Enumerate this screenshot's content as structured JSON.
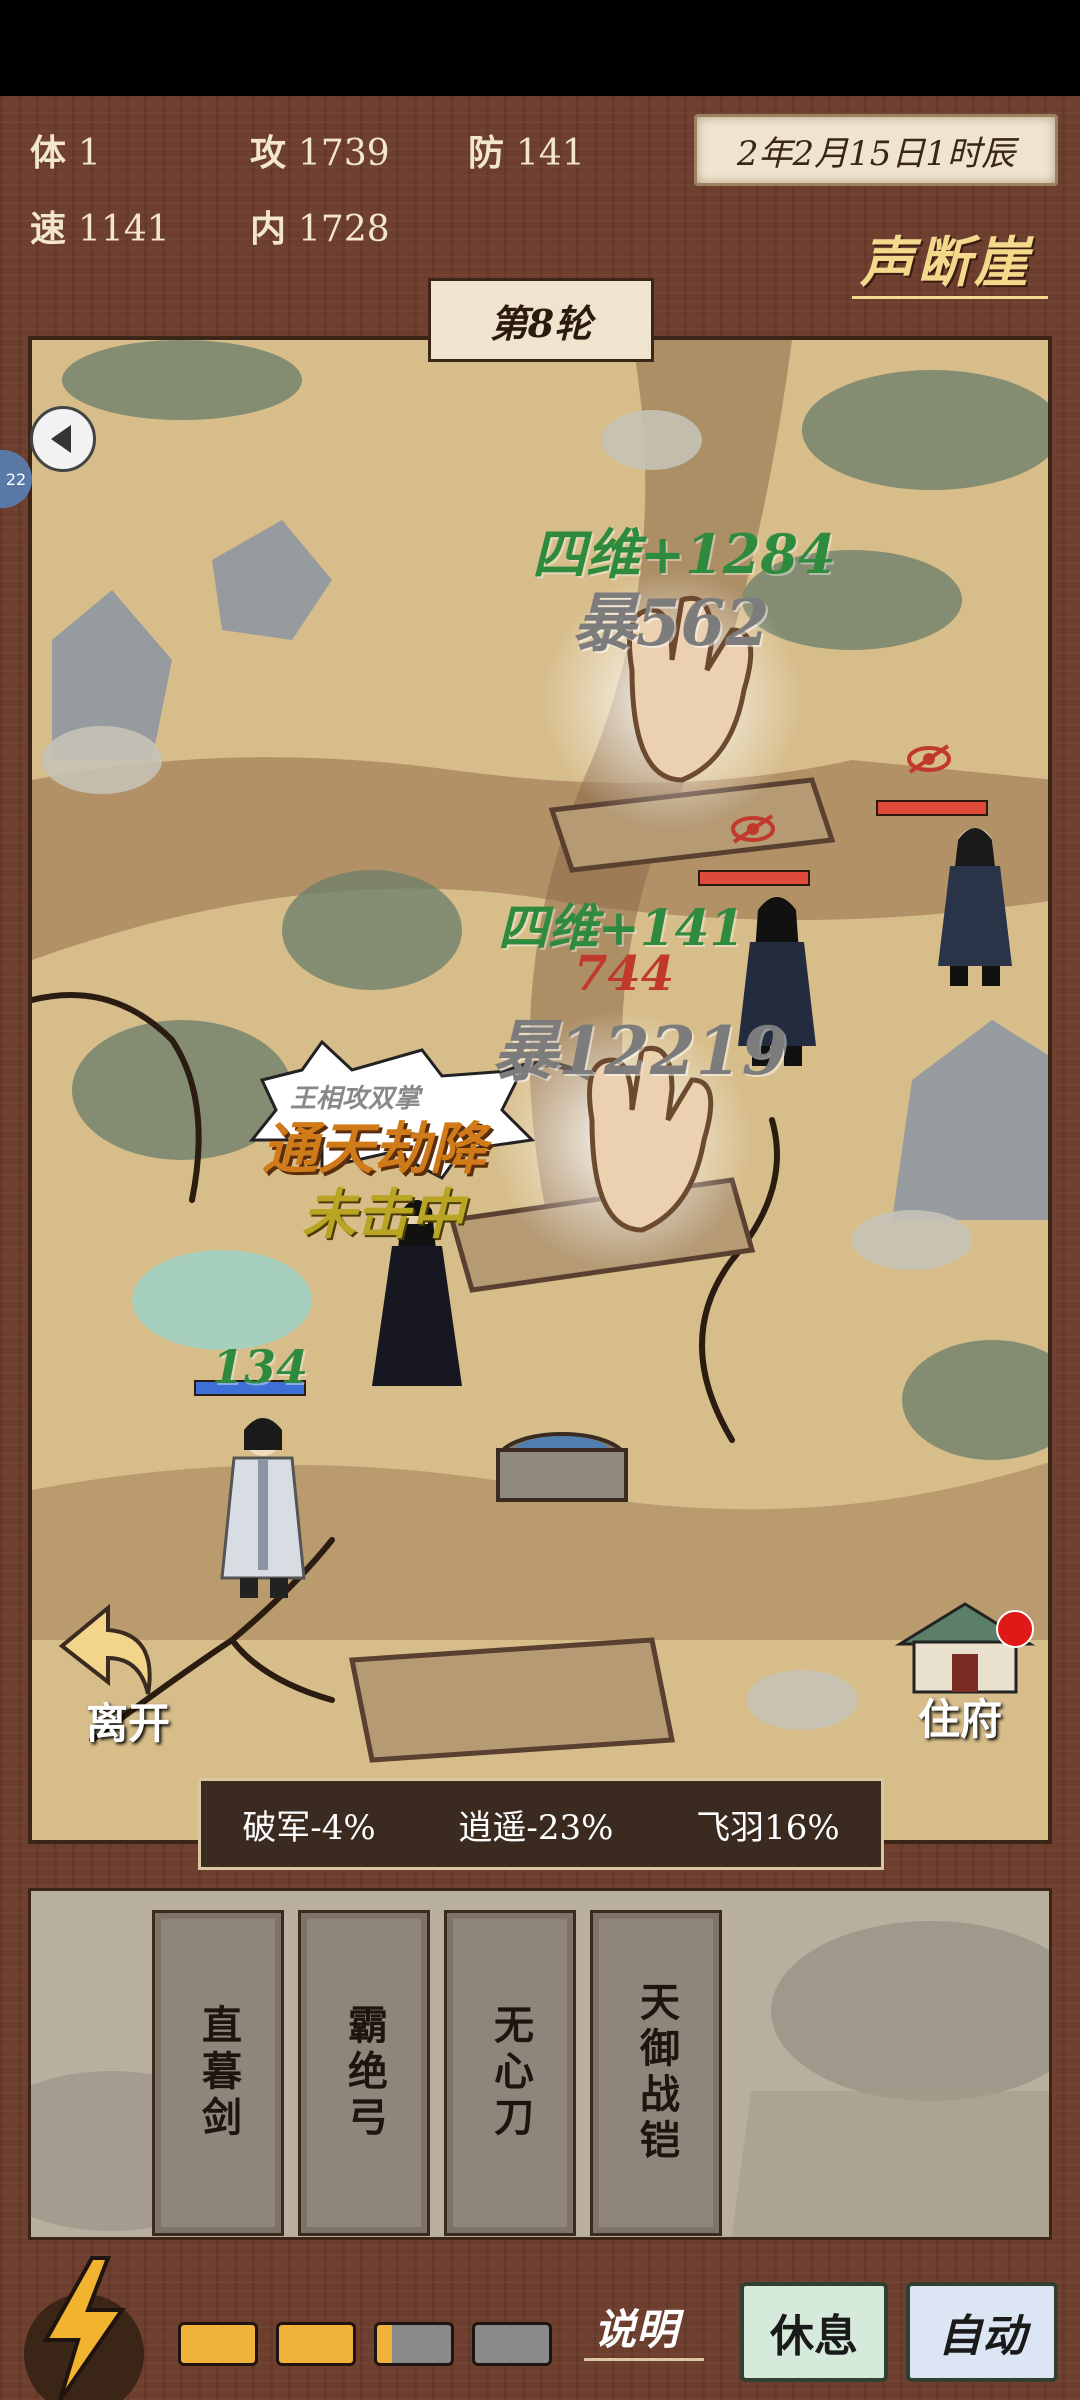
{
  "stats": {
    "ti": {
      "key": "体",
      "value": "1"
    },
    "gong": {
      "key": "攻",
      "value": "1739"
    },
    "fang": {
      "key": "防",
      "value": "141"
    },
    "su": {
      "key": "速",
      "value": "1141"
    },
    "nei": {
      "key": "内",
      "value": "1728"
    }
  },
  "date": "2年2月15日1时辰",
  "location": "声断崖",
  "round": "第8轮",
  "side_badge": "22",
  "combat_text": {
    "buff_top": "四维+1284",
    "crit_top": "暴562",
    "buff_mid": "四维+141",
    "dmg_mid": "744",
    "crit_mid": "暴12219",
    "skill_name": "通天劫降",
    "miss": "未击中",
    "speech": "王相攻双掌",
    "player_hp": "134"
  },
  "actions": {
    "leave": "离开",
    "home": "住府"
  },
  "buffs": [
    "破军-4%",
    "逍遥-23%",
    "飞羽16%"
  ],
  "cards": [
    "直暮剑",
    "霸绝弓",
    "无心刀",
    "天御战铠"
  ],
  "energy": {
    "filled": 2,
    "partial": 1,
    "total": 4
  },
  "buttons": {
    "help": "说明",
    "rest": "休息",
    "auto": "自动"
  },
  "colors": {
    "frame": "#6e3e2e",
    "parchment": "#efe5cf",
    "location_gold": "#f4d98c",
    "buff_green": "#2e8b3e",
    "energy_gold": "#f0b23a",
    "hp_red": "#e04a3a",
    "hp_blue": "#3d6fd6"
  }
}
